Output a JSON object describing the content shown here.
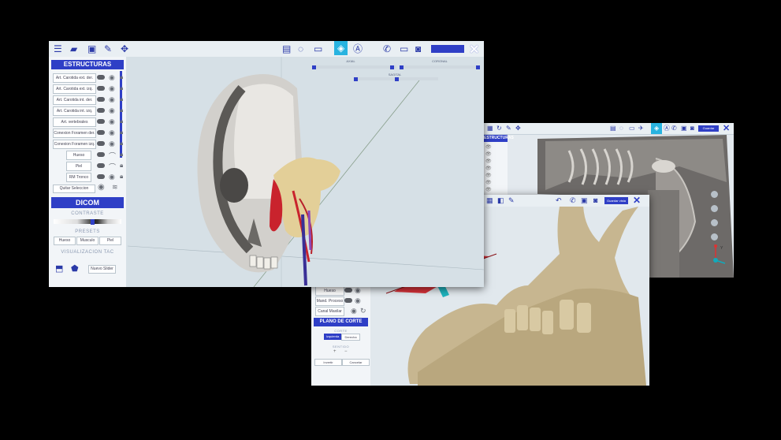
{
  "main_window": {
    "toolbar": {
      "right_button_label": "",
      "icons": [
        "menu-icon",
        "folder-icon",
        "save-icon",
        "brush-icon",
        "move-icon",
        "layers-icon",
        "circle-select-icon",
        "screen-icon",
        "stack-icon",
        "atlas-icon",
        "phone-icon",
        "record-icon",
        "camera-icon"
      ]
    },
    "estructuras": {
      "title": "ESTRUCTURAS",
      "items": [
        "Art. Carotida ext. der.",
        "Art. Carotida ext. izq.",
        "Art. Carotida int. der.",
        "Art. Carotida int. izq.",
        "Art. vertebrales",
        "Conexion Foramen der.",
        "Conexion Foramen izq.",
        "Hueso",
        "Piel",
        "RM Tronco"
      ],
      "quitar_label": "Quitar Seleccion"
    },
    "dicom": {
      "title": "DICOM",
      "contraste_label": "CONTRASTE",
      "presets_label": "PRESETS",
      "presets": [
        "Hueso",
        "Musculo",
        "Piel"
      ],
      "visualizacion_label": "VISUALIZACION TAC",
      "nuevo_slider_label": "Nuevo Slider"
    },
    "sliders": {
      "axial": "AXIAL",
      "coronal": "CORONAL",
      "sagital": "SAGITAL"
    }
  },
  "jaw_window": {
    "layer_items": [
      "Hueso",
      "Mand. Proceso",
      "Canal Maxilar"
    ],
    "plano_title": "PLANO DE CORTE",
    "plano_label": "CORTE",
    "plano_options": [
      "Izquierda",
      "Derecha"
    ],
    "sub_label": "SENTIDO",
    "bottom_buttons": [
      "Invertir",
      "Cancelar"
    ],
    "toolbar_button": "Guardar vista"
  },
  "chest_window": {
    "estructuras_title": "ESTRUCTURAS",
    "toolbar_button": "Guardar",
    "axis_labels": {
      "y": "Y",
      "x": "X"
    }
  }
}
